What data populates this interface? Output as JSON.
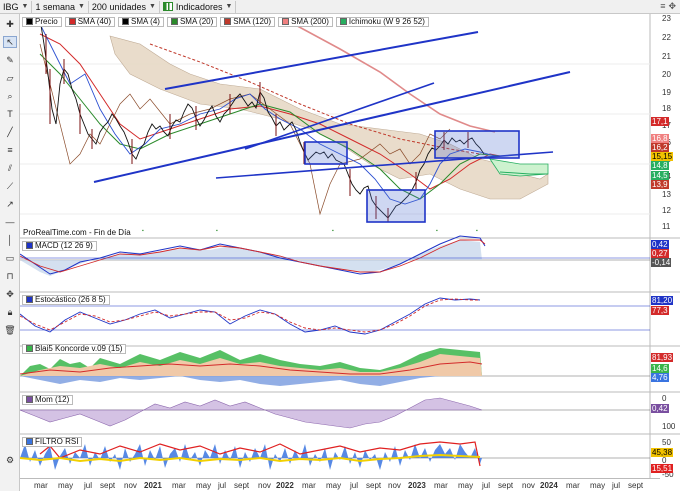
{
  "toolbar": {
    "symbol": "IBG",
    "timeframe": "1 semana",
    "units": "200 unidades",
    "indicators_label": "Indicadores",
    "window_buttons": [
      "≡",
      "✥"
    ]
  },
  "main_panel": {
    "legend": [
      {
        "label": "Precio",
        "color": "#000000"
      },
      {
        "label": "SMA (40)",
        "color": "#d32a2a"
      },
      {
        "label": "SMA (4)",
        "color": "#000000"
      },
      {
        "label": "SMA (20)",
        "color": "#2a8a2a"
      },
      {
        "label": "SMA (120)",
        "color": "#c0392b"
      },
      {
        "label": "SMA (200)",
        "color": "#f08080"
      },
      {
        "label": "Ichimoku (W 9 26 52)",
        "color": "#27ae60"
      }
    ],
    "source_text": "ProRealTime.com - Fin de Día",
    "y_ticks": [
      "23",
      "22",
      "21",
      "20",
      "19",
      "18",
      "17",
      "16",
      "15",
      "14",
      "13",
      "12",
      "11"
    ],
    "price_tags": [
      {
        "text": "17,1",
        "color": "#d32a2a"
      },
      {
        "text": "16,8",
        "color": "#f08080"
      },
      {
        "text": "16,2",
        "color": "#c0392b"
      },
      {
        "text": "15,15",
        "color": "#f2c200"
      },
      {
        "text": "14,8",
        "color": "#27ae60"
      },
      {
        "text": "14,5",
        "color": "#27ae60"
      },
      {
        "text": "13,9",
        "color": "#c0392b"
      }
    ]
  },
  "macd": {
    "label": "MACD (12 26 9)",
    "tags": [
      "0,42",
      "0,27",
      "-0,14"
    ]
  },
  "stochastic": {
    "label": "Estocástico (26 8 5)",
    "tags": [
      "81,20",
      "77,3"
    ]
  },
  "koncorde": {
    "label": "Blai5 Koncorde v.09 (15)",
    "tags": [
      "81,93",
      "14,6",
      "4,76"
    ]
  },
  "momentum": {
    "label": "Mom (12)",
    "tags": [
      "0,42"
    ],
    "y_ticks": [
      "0"
    ]
  },
  "rsi": {
    "label": "FILTRO RSI",
    "tags": [
      "45,38",
      "15,51"
    ],
    "y_ticks": [
      "100",
      "50",
      "0",
      "-50"
    ]
  },
  "x_axis": {
    "labels": [
      "mar",
      "may",
      "jul",
      "sept",
      "nov",
      "2021",
      "mar",
      "may",
      "jul",
      "sept",
      "nov",
      "2022",
      "mar",
      "may",
      "jul",
      "sept",
      "nov",
      "2023",
      "mar",
      "may",
      "jul",
      "sept",
      "nov",
      "2024",
      "mar",
      "may",
      "jul",
      "sept"
    ],
    "bold": [
      "2021",
      "2022",
      "2023",
      "2024"
    ]
  }
}
